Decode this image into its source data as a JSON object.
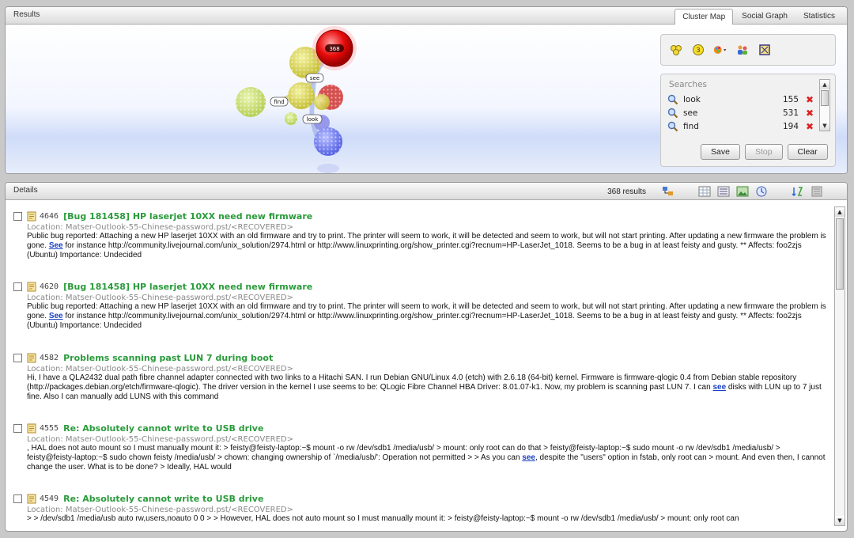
{
  "results": {
    "title": "Results",
    "tabs": [
      {
        "label": "Cluster Map"
      },
      {
        "label": "Social Graph"
      },
      {
        "label": "Statistics"
      }
    ],
    "cluster": {
      "top_count": "368",
      "labels": [
        "see",
        "find",
        "look"
      ]
    },
    "searches": {
      "title": "Searches",
      "items": [
        {
          "term": "look",
          "count": "155"
        },
        {
          "term": "see",
          "count": "531"
        },
        {
          "term": "find",
          "count": "194"
        }
      ],
      "save_label": "Save",
      "stop_label": "Stop",
      "clear_label": "Clear"
    }
  },
  "details": {
    "title": "Details",
    "count_label": "368 results",
    "items": [
      {
        "id": "4646",
        "title": "[Bug 181458] HP laserjet 10XX need new firmware",
        "location": "Location: Matser-Outlook-55-Chinese-password.pst/<RECOVERED>",
        "body_before": "Public bug reported: Attaching a new HP laserjet 10XX with an old firmware and try to print. The printer will seem to work, it will be detected and seem to work, but will not start printing. After updating a new firmware the problem is gone. ",
        "link": "See",
        "body_after": " for instance http://community.livejournal.com/unix_solution/2974.html or http://www.linuxprinting.org/show_printer.cgi?recnum=HP-LaserJet_1018. Seems to be a bug in at least feisty and gusty. ** Affects: foo2zjs (Ubuntu) Importance: Undecided"
      },
      {
        "id": "4620",
        "title": "[Bug 181458] HP laserjet 10XX need new firmware",
        "location": "Location: Matser-Outlook-55-Chinese-password.pst/<RECOVERED>",
        "body_before": "Public bug reported: Attaching a new HP laserjet 10XX with an old firmware and try to print. The printer will seem to work, it will be detected and seem to work, but will not start printing. After updating a new firmware the problem is gone. ",
        "link": "See",
        "body_after": " for instance http://community.livejournal.com/unix_solution/2974.html or http://www.linuxprinting.org/show_printer.cgi?recnum=HP-LaserJet_1018. Seems to be a bug in at least feisty and gusty. ** Affects: foo2zjs (Ubuntu) Importance: Undecided"
      },
      {
        "id": "4582",
        "title": "Problems scanning past LUN 7 during boot",
        "location": "Location: Matser-Outlook-55-Chinese-password.pst/<RECOVERED>",
        "body_before": "Hi, I have a QLA2432 dual path fibre channel adapter connected with two links to a Hitachi SAN. I run Debian GNU/Linux 4.0 (etch) with 2.6.18 (64-bit) kernel. Firmware is firmware-qlogic 0.4 from Debian stable repository (http://packages.debian.org/etch/firmware-qlogic). The driver version in the kernel I use seems to be: QLogic Fibre Channel HBA Driver: 8.01.07-k1. Now, my problem is scanning past LUN 7. I can ",
        "link": "see",
        "body_after": " disks with LUN up to 7 just fine. Also I can manually add LUNS with this command"
      },
      {
        "id": "4555",
        "title": "Re: Absolutely cannot write to USB drive",
        "location": "Location: Matser-Outlook-55-Chinese-password.pst/<RECOVERED>",
        "body_before": ", HAL does not auto mount so I must manually mount it: > feisty@feisty-laptop:~$ mount -o rw /dev/sdb1 /media/usb/ > mount: only root can do that > feisty@feisty-laptop:~$ sudo mount -o rw /dev/sdb1 /media/usb/ > feisty@feisty-laptop:~$ sudo chown feisty /media/usb/ > chown: changing ownership of `/media/usb/': Operation not permitted > > As you can ",
        "link": "see",
        "body_after": ", despite the \"users\" option in fstab, only root can > mount. And even then, I cannot change the user. What is to be done? > Ideally, HAL would"
      },
      {
        "id": "4549",
        "title": "Re: Absolutely cannot write to USB drive",
        "location": "Location: Matser-Outlook-55-Chinese-password.pst/<RECOVERED>",
        "body_before": "> > /dev/sdb1 /media/usb auto rw,users,noauto 0 0 > > However, HAL does not auto mount so I must manually mount it: > feisty@feisty-laptop:~$ mount -o rw /dev/sdb1 /media/usb/ > mount: only root can",
        "link": "",
        "body_after": ""
      }
    ]
  }
}
